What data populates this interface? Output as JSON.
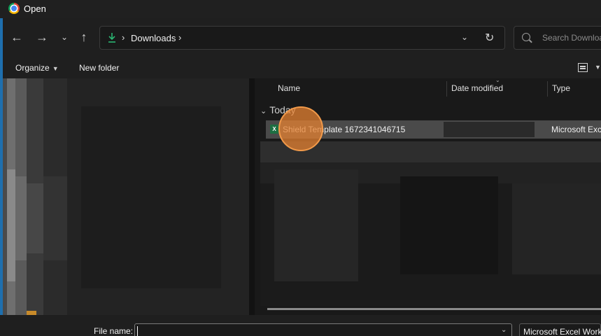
{
  "window": {
    "title": "Open",
    "app_icon": "chrome-icon"
  },
  "nav": {
    "back_icon": "arrow-left-icon",
    "forward_icon": "arrow-right-icon",
    "recent_icon": "chevron-down-icon",
    "up_icon": "arrow-up-icon"
  },
  "address": {
    "location_icon": "download-icon",
    "crumbs": [
      "Downloads"
    ],
    "separator": "›",
    "dropdown_icon": "chevron-down-icon",
    "refresh_icon": "refresh-icon"
  },
  "search": {
    "placeholder": "Search Downloads"
  },
  "toolbar": {
    "organize_label": "Organize",
    "new_folder_label": "New folder",
    "view_icon": "details-view-icon"
  },
  "columns": {
    "name": "Name",
    "date_modified": "Date modified",
    "type": "Type"
  },
  "group": {
    "label": "Today"
  },
  "files": [
    {
      "name": "Shield Template 1672341046715",
      "date_modified": "",
      "type": "Microsoft Excel",
      "icon": "excel-icon"
    }
  ],
  "footer": {
    "file_name_label": "File name:",
    "file_name_value": "",
    "filter_value": "Microsoft Excel Worksheet"
  },
  "colors": {
    "accent": "#f29a4a",
    "excel": "#1d6f42",
    "background": "#191919"
  }
}
